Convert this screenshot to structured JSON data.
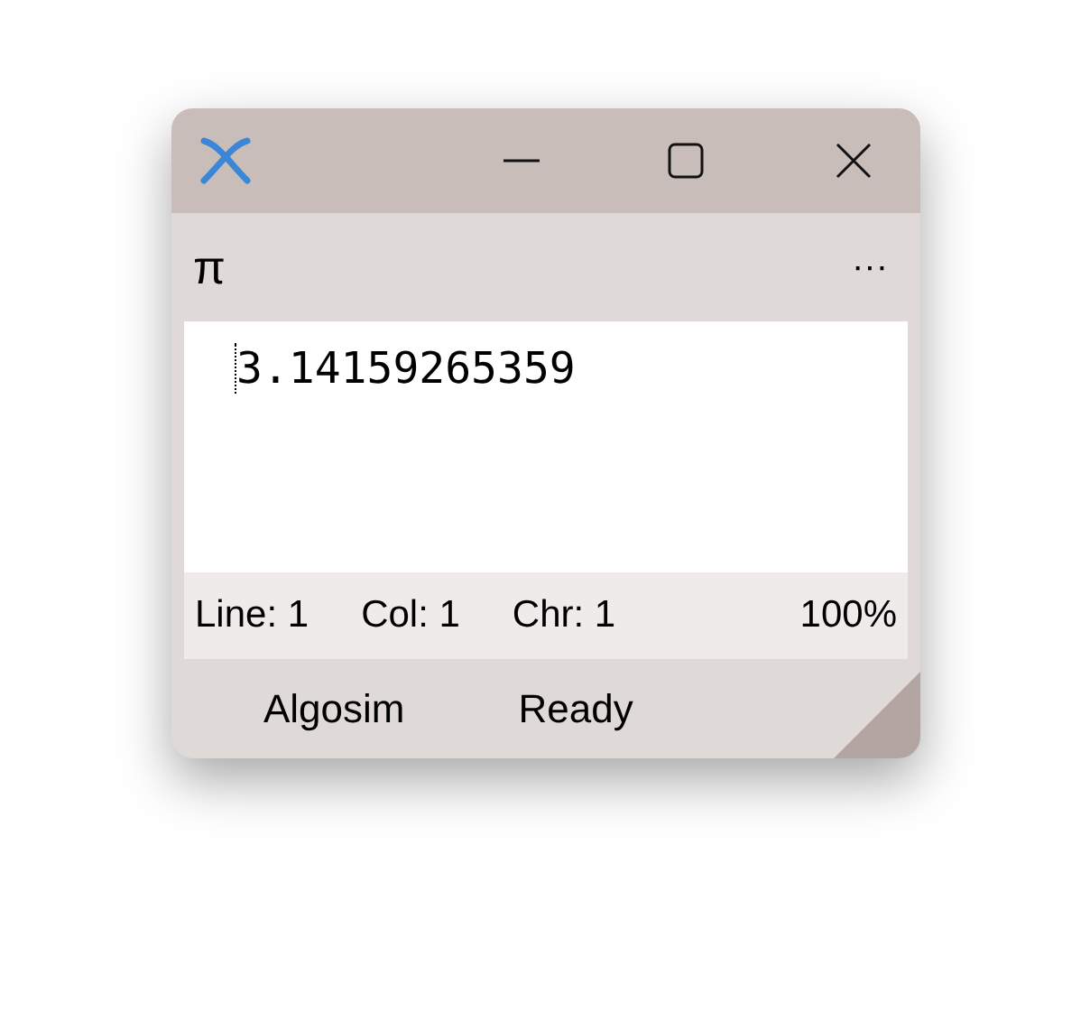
{
  "toolbar": {
    "title": "π",
    "menu": "···"
  },
  "editor": {
    "text": "3.14159265359"
  },
  "status_bar": {
    "line": "Line: 1",
    "col": "Col: 1",
    "chr": "Chr: 1",
    "zoom": "100%"
  },
  "footer": {
    "app": "Algosim",
    "state": "Ready"
  }
}
